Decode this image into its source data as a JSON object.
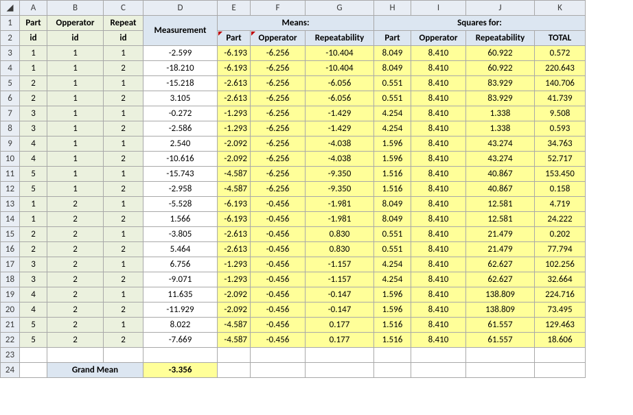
{
  "columns": [
    "A",
    "B",
    "C",
    "D",
    "E",
    "F",
    "G",
    "H",
    "I",
    "J",
    "K"
  ],
  "row_numbers": [
    1,
    2,
    3,
    4,
    5,
    6,
    7,
    8,
    9,
    10,
    11,
    12,
    13,
    14,
    15,
    16,
    17,
    18,
    19,
    20,
    21,
    22,
    23,
    24
  ],
  "headers": {
    "part_id_1": "Part",
    "part_id_2": "id",
    "opp_id_1": "Opperator",
    "opp_id_2": "id",
    "rep_id_1": "Repeat",
    "rep_id_2": "id",
    "measurement": "Measurement",
    "means": "Means:",
    "squares_for": "Squares for:",
    "part": "Part",
    "opperator": "Opperator",
    "repeatability": "Repeatability",
    "total": "TOTAL"
  },
  "grand_mean_label": "Grand Mean",
  "grand_mean_value": "-3.356",
  "chart_data": {
    "type": "table",
    "columns": [
      "Part id",
      "Opperator id",
      "Repeat id",
      "Measurement",
      "Mean Part",
      "Mean Opperator",
      "Mean Repeatability",
      "Sq Part",
      "Sq Opperator",
      "Sq Repeatability",
      "Sq TOTAL"
    ],
    "rows": [
      [
        "1",
        "1",
        "1",
        "-2.599",
        "-6.193",
        "-6.256",
        "-10.404",
        "8.049",
        "8.410",
        "60.922",
        "0.572"
      ],
      [
        "1",
        "1",
        "2",
        "-18.210",
        "-6.193",
        "-6.256",
        "-10.404",
        "8.049",
        "8.410",
        "60.922",
        "220.643"
      ],
      [
        "2",
        "1",
        "1",
        "-15.218",
        "-2.613",
        "-6.256",
        "-6.056",
        "0.551",
        "8.410",
        "83.929",
        "140.706"
      ],
      [
        "2",
        "1",
        "2",
        "3.105",
        "-2.613",
        "-6.256",
        "-6.056",
        "0.551",
        "8.410",
        "83.929",
        "41.739"
      ],
      [
        "3",
        "1",
        "1",
        "-0.272",
        "-1.293",
        "-6.256",
        "-1.429",
        "4.254",
        "8.410",
        "1.338",
        "9.508"
      ],
      [
        "3",
        "1",
        "2",
        "-2.586",
        "-1.293",
        "-6.256",
        "-1.429",
        "4.254",
        "8.410",
        "1.338",
        "0.593"
      ],
      [
        "4",
        "1",
        "1",
        "2.540",
        "-2.092",
        "-6.256",
        "-4.038",
        "1.596",
        "8.410",
        "43.274",
        "34.763"
      ],
      [
        "4",
        "1",
        "2",
        "-10.616",
        "-2.092",
        "-6.256",
        "-4.038",
        "1.596",
        "8.410",
        "43.274",
        "52.717"
      ],
      [
        "5",
        "1",
        "1",
        "-15.743",
        "-4.587",
        "-6.256",
        "-9.350",
        "1.516",
        "8.410",
        "40.867",
        "153.450"
      ],
      [
        "5",
        "1",
        "2",
        "-2.958",
        "-4.587",
        "-6.256",
        "-9.350",
        "1.516",
        "8.410",
        "40.867",
        "0.158"
      ],
      [
        "1",
        "2",
        "1",
        "-5.528",
        "-6.193",
        "-0.456",
        "-1.981",
        "8.049",
        "8.410",
        "12.581",
        "4.719"
      ],
      [
        "1",
        "2",
        "2",
        "1.566",
        "-6.193",
        "-0.456",
        "-1.981",
        "8.049",
        "8.410",
        "12.581",
        "24.222"
      ],
      [
        "2",
        "2",
        "1",
        "-3.805",
        "-2.613",
        "-0.456",
        "0.830",
        "0.551",
        "8.410",
        "21.479",
        "0.202"
      ],
      [
        "2",
        "2",
        "2",
        "5.464",
        "-2.613",
        "-0.456",
        "0.830",
        "0.551",
        "8.410",
        "21.479",
        "77.794"
      ],
      [
        "3",
        "2",
        "1",
        "6.756",
        "-1.293",
        "-0.456",
        "-1.157",
        "4.254",
        "8.410",
        "62.627",
        "102.256"
      ],
      [
        "3",
        "2",
        "2",
        "-9.071",
        "-1.293",
        "-0.456",
        "-1.157",
        "4.254",
        "8.410",
        "62.627",
        "32.664"
      ],
      [
        "4",
        "2",
        "1",
        "11.635",
        "-2.092",
        "-0.456",
        "-0.147",
        "1.596",
        "8.410",
        "138.809",
        "224.716"
      ],
      [
        "4",
        "2",
        "2",
        "-11.929",
        "-2.092",
        "-0.456",
        "-0.147",
        "1.596",
        "8.410",
        "138.809",
        "73.495"
      ],
      [
        "5",
        "2",
        "1",
        "8.022",
        "-4.587",
        "-0.456",
        "0.177",
        "1.516",
        "8.410",
        "61.557",
        "129.463"
      ],
      [
        "5",
        "2",
        "2",
        "-7.669",
        "-4.587",
        "-0.456",
        "0.177",
        "1.516",
        "8.410",
        "61.557",
        "18.606"
      ]
    ],
    "grand_mean": -3.356
  }
}
